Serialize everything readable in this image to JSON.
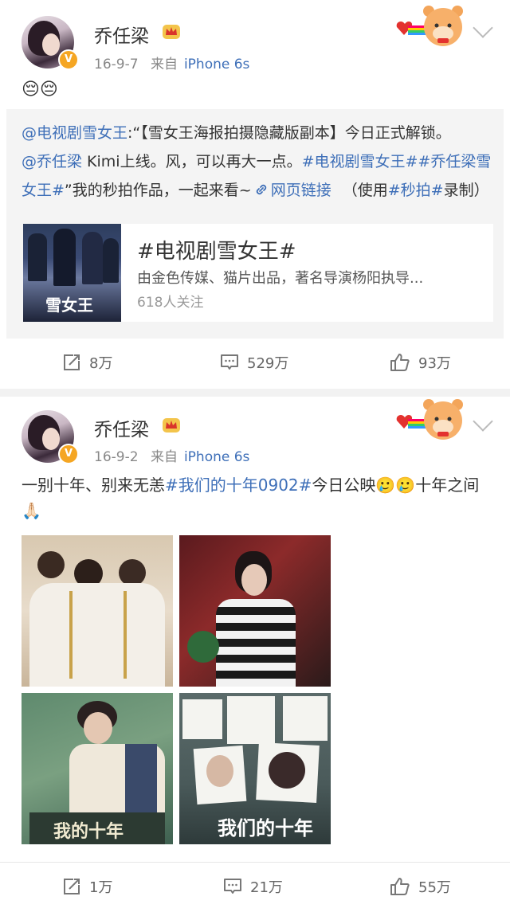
{
  "colors": {
    "link": "#3e6fb8",
    "verified": "#f5a623"
  },
  "posts": [
    {
      "username": "乔任梁",
      "date": "16-9-7",
      "source_prefix": "来自",
      "source": "iPhone 6s",
      "body": "😔😔",
      "repost": {
        "seg1": "@电视剧雪女王",
        "seg2": ":“【雪女王海报拍摄隐藏版副本】今日正式解锁。",
        "seg3": "@乔任梁",
        "seg4": " Kimi上线。风，可以再大一点。",
        "seg5": "#电视剧雪女王##乔任梁雪女王#",
        "seg6": "”我的秒拍作品，一起来看~",
        "seg7": "网页链接",
        "seg8": "（使用",
        "seg9": "#秒拍#",
        "seg10": "录制）",
        "card": {
          "title": "#电视剧雪女王#",
          "desc": "由金色传媒、猫片出品，著名导演杨阳执导...",
          "followers": "618人关注",
          "poster_text": "雪女王"
        }
      },
      "actions": {
        "repost": "8万",
        "comment": "529万",
        "like": "93万"
      }
    },
    {
      "username": "乔任梁",
      "date": "16-9-2",
      "source_prefix": "来自",
      "source": "iPhone 6s",
      "body_seg1": "一别十年、别来无恙",
      "body_seg2": "#我们的十年0902#",
      "body_seg3": "今日公映🥲🥲十年之间🙏🏻",
      "photo_texts": {
        "p3": "我的十年",
        "p4": "我们的十年"
      },
      "actions": {
        "repost": "1万",
        "comment": "21万",
        "like": "55万"
      }
    }
  ],
  "icons": [
    "repost-icon",
    "comment-icon",
    "like-icon",
    "crown-icon",
    "chevron-down-icon",
    "bear-sticker-icon",
    "link-icon"
  ]
}
